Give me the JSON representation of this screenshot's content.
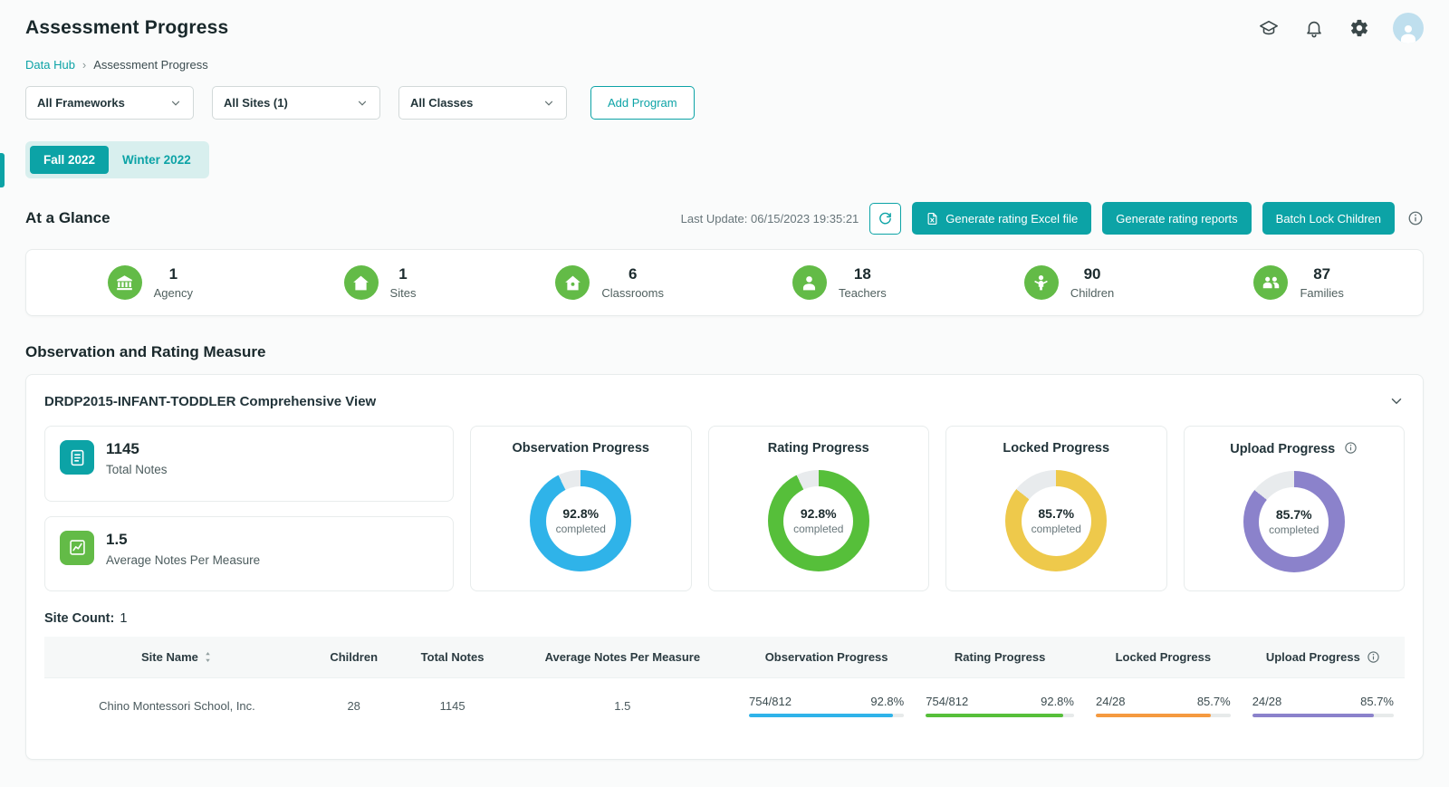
{
  "header": {
    "title": "Assessment Progress"
  },
  "breadcrumb": {
    "items": [
      "Data Hub",
      "Assessment Progress"
    ],
    "separator": "›"
  },
  "filters": {
    "frameworks_label": "All Frameworks",
    "sites_label": "All Sites (1)",
    "classes_label": "All Classes",
    "add_program_label": "Add Program"
  },
  "tabs": {
    "fall": "Fall 2022",
    "winter": "Winter 2022"
  },
  "at_a_glance": {
    "title": "At a Glance",
    "last_update": "Last Update: 06/15/2023 19:35:21",
    "generate_excel_label": "Generate rating Excel file",
    "generate_reports_label": "Generate rating reports",
    "batch_lock_label": "Batch Lock Children",
    "stats": [
      {
        "value": "1",
        "label": "Agency"
      },
      {
        "value": "1",
        "label": "Sites"
      },
      {
        "value": "6",
        "label": "Classrooms"
      },
      {
        "value": "18",
        "label": "Teachers"
      },
      {
        "value": "90",
        "label": "Children"
      },
      {
        "value": "87",
        "label": "Families"
      }
    ]
  },
  "observation_section": {
    "title": "Observation and Rating Measure",
    "card_title": "DRDP2015-INFANT-TODDLER Comprehensive View",
    "summary_cards": [
      {
        "value": "1145",
        "label": "Total Notes"
      },
      {
        "value": "1.5",
        "label": "Average Notes Per Measure"
      }
    ],
    "donuts": [
      {
        "title": "Observation Progress",
        "percent": 92.8,
        "display": "92.8%",
        "subtext": "completed",
        "color": "#2fb3e9"
      },
      {
        "title": "Rating Progress",
        "percent": 92.8,
        "display": "92.8%",
        "subtext": "completed",
        "color": "#56bf3a"
      },
      {
        "title": "Locked Progress",
        "percent": 85.7,
        "display": "85.7%",
        "subtext": "completed",
        "color": "#eec94b"
      },
      {
        "title": "Upload Progress",
        "percent": 85.7,
        "display": "85.7%",
        "subtext": "completed",
        "color": "#8b82cb"
      }
    ],
    "site_count_label": "Site Count:",
    "site_count_value": "1"
  },
  "table": {
    "columns": [
      "Site Name",
      "Children",
      "Total Notes",
      "Average Notes Per Measure",
      "Observation Progress",
      "Rating Progress",
      "Locked Progress",
      "Upload Progress"
    ],
    "rows": [
      {
        "site_name": "Chino Montessori School, Inc.",
        "children": "28",
        "total_notes": "1145",
        "avg_notes": "1.5",
        "observation": {
          "fraction": "754/812",
          "percent": "92.8%",
          "value": 92.8,
          "color": "#2fb3e9"
        },
        "rating": {
          "fraction": "754/812",
          "percent": "92.8%",
          "value": 92.8,
          "color": "#56bf3a"
        },
        "locked": {
          "fraction": "24/28",
          "percent": "85.7%",
          "value": 85.7,
          "color": "#f59a40"
        },
        "upload": {
          "fraction": "24/28",
          "percent": "85.7%",
          "value": 85.7,
          "color": "#8b82cb"
        }
      }
    ]
  },
  "colors": {
    "primary": "#0ca3a6",
    "stat_icon_green": "#63bb47"
  }
}
